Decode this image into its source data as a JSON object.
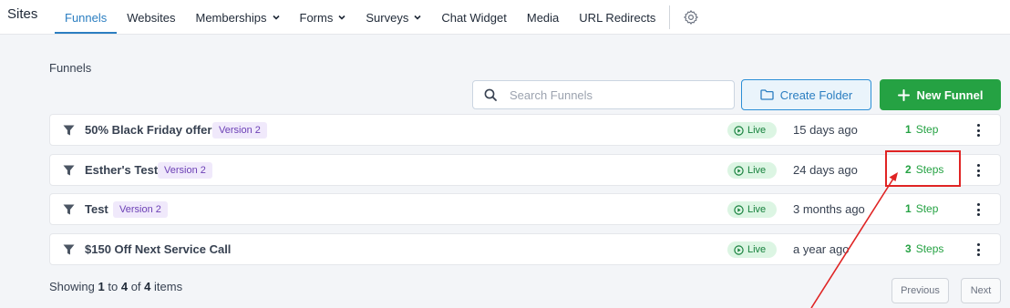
{
  "nav": {
    "brand": "Sites",
    "links": [
      {
        "label": "Funnels",
        "active": true,
        "dropdown": false
      },
      {
        "label": "Websites",
        "active": false,
        "dropdown": false
      },
      {
        "label": "Memberships",
        "active": false,
        "dropdown": true
      },
      {
        "label": "Forms",
        "active": false,
        "dropdown": true
      },
      {
        "label": "Surveys",
        "active": false,
        "dropdown": true
      },
      {
        "label": "Chat Widget",
        "active": false,
        "dropdown": false
      },
      {
        "label": "Media",
        "active": false,
        "dropdown": false
      },
      {
        "label": "URL Redirects",
        "active": false,
        "dropdown": false
      }
    ],
    "settings_icon": "gear-icon"
  },
  "page": {
    "title": "Funnels"
  },
  "search": {
    "placeholder": "Search Funnels",
    "value": ""
  },
  "actions": {
    "create_folder": "Create Folder",
    "new_funnel": "New Funnel"
  },
  "funnels": [
    {
      "name": "50% Black Friday offer",
      "version": "Version 2",
      "status": "Live",
      "updated": "15 days ago",
      "step_count": "1",
      "step_label": "Step"
    },
    {
      "name": "Esther's Test",
      "version": "Version 2",
      "status": "Live",
      "updated": "24 days ago",
      "step_count": "2",
      "step_label": "Steps"
    },
    {
      "name": "Test",
      "version": "Version 2",
      "status": "Live",
      "updated": "3 months ago",
      "step_count": "1",
      "step_label": "Step"
    },
    {
      "name": "$150 Off Next Service Call",
      "version": "",
      "status": "Live",
      "updated": "a year ago",
      "step_count": "3",
      "step_label": "Steps"
    }
  ],
  "footer": {
    "showing_prefix": "Showing",
    "from": "1",
    "to_word": "to",
    "to": "4",
    "of_word": "of",
    "total": "4",
    "items_word": "items",
    "previous": "Previous",
    "next": "Next"
  },
  "colors": {
    "accent": "#2b7ec1",
    "success": "#25a243",
    "annotation": "#e02424",
    "version_badge": "#6b3fb5"
  }
}
